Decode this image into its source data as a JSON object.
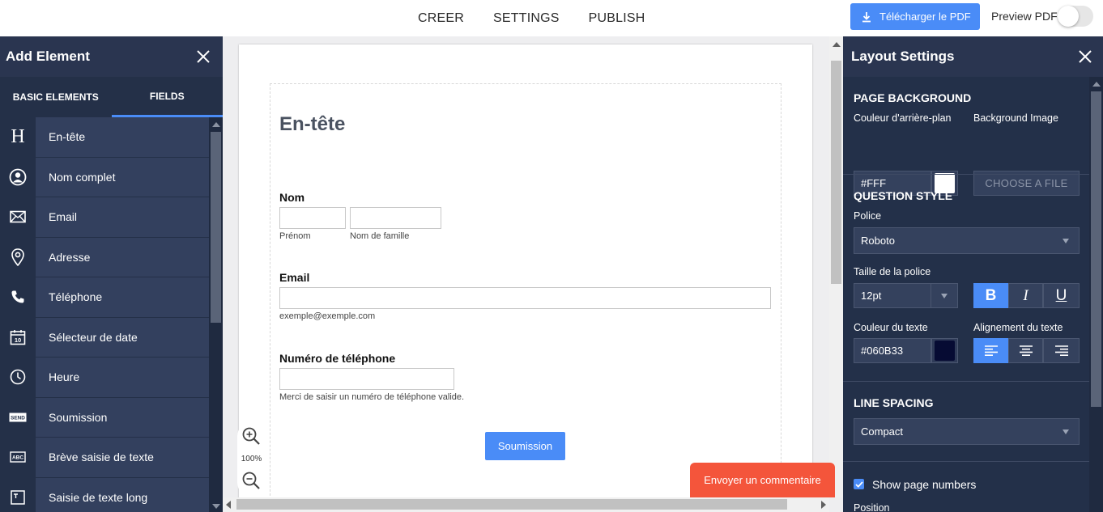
{
  "topbar": {
    "nav": [
      "CREER",
      "SETTINGS",
      "PUBLISH"
    ],
    "download_label": "Télécharger le PDF",
    "preview_label": "Preview PDF",
    "preview_on": false
  },
  "left_panel": {
    "title": "Add Element",
    "tabs": [
      "BASIC ELEMENTS",
      "FIELDS"
    ],
    "active_tab": "FIELDS",
    "items": [
      {
        "label": "En-tête",
        "icon": "heading-icon"
      },
      {
        "label": "Nom complet",
        "icon": "user-icon"
      },
      {
        "label": "Email",
        "icon": "envelope-icon"
      },
      {
        "label": "Adresse",
        "icon": "location-pin-icon"
      },
      {
        "label": "Téléphone",
        "icon": "phone-icon"
      },
      {
        "label": "Sélecteur de date",
        "icon": "calendar-icon"
      },
      {
        "label": "Heure",
        "icon": "clock-icon"
      },
      {
        "label": "Soumission",
        "icon": "send-icon"
      },
      {
        "label": "Brève saisie de texte",
        "icon": "short-text-icon"
      },
      {
        "label": "Saisie de texte long",
        "icon": "long-text-icon"
      }
    ],
    "calendar_day": "10",
    "send_text": "SEND",
    "short_text": "ABC"
  },
  "form": {
    "heading": "En-tête",
    "name_label": "Nom",
    "first_sub": "Prénom",
    "last_sub": "Nom de famille",
    "email_label": "Email",
    "email_sub": "exemple@exemple.com",
    "phone_label": "Numéro de téléphone",
    "phone_sub": "Merci de saisir un numéro de téléphone valide.",
    "submit_label": "Soumission"
  },
  "zoom": {
    "level": "100%"
  },
  "feedback": {
    "label": "Envoyer un commentaire"
  },
  "right_panel": {
    "title": "Layout Settings",
    "page_bg": {
      "title": "PAGE BACKGROUND",
      "color_label": "Couleur d'arrière-plan",
      "color_value": "#FFF",
      "image_label": "Background Image",
      "choose_label": "CHOOSE A FILE"
    },
    "question_style": {
      "title": "QUESTION STYLE",
      "font_label": "Police",
      "font_value": "Roboto",
      "size_label": "Taille de la police",
      "size_value": "12pt",
      "bold": "B",
      "italic": "I",
      "underline": "U",
      "text_color_label": "Couleur du texte",
      "text_color_value": "#060B33",
      "align_label": "Alignement du texte"
    },
    "line_spacing": {
      "title": "LINE SPACING",
      "value": "Compact"
    },
    "show_page_numbers": "Show page numbers",
    "position_label": "Position"
  },
  "colors": {
    "accent": "#4a8cf7",
    "panel": "#2d3a55",
    "feedback": "#f4553b",
    "text_swatch": "#060B33"
  }
}
